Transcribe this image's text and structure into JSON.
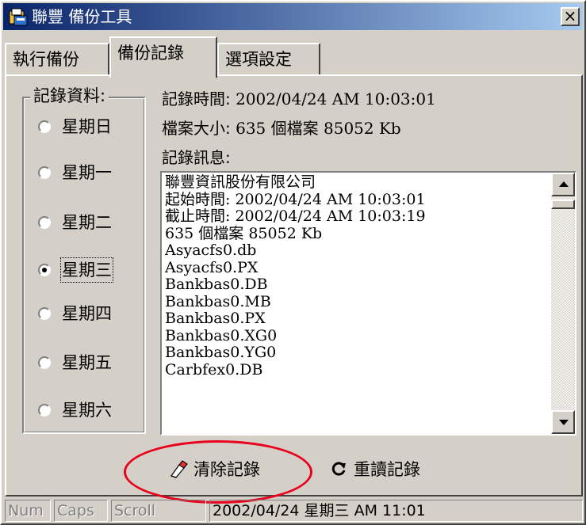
{
  "window": {
    "title": "聯豐 備份工具",
    "close_glyph": "×"
  },
  "tabs": [
    {
      "label": "執行備份",
      "active": false
    },
    {
      "label": "備份記錄",
      "active": true
    },
    {
      "label": "選項設定",
      "active": false
    }
  ],
  "records_group": {
    "label": "記錄資料:",
    "days": [
      {
        "label": "星期日",
        "selected": false
      },
      {
        "label": "星期一",
        "selected": false
      },
      {
        "label": "星期二",
        "selected": false
      },
      {
        "label": "星期三",
        "selected": true
      },
      {
        "label": "星期四",
        "selected": false
      },
      {
        "label": "星期五",
        "selected": false
      },
      {
        "label": "星期六",
        "selected": false
      }
    ]
  },
  "record_info": {
    "time_label": "記錄時間:",
    "time_value": "2002/04/24 AM 10:03:01",
    "size_label": "檔案大小:",
    "size_value": "635 個檔案 85052 Kb",
    "message_label": "記錄訊息:"
  },
  "message_lines": [
    "聯豐資訊股份有限公司",
    "起始時間: 2002/04/24 AM 10:03:01",
    "截止時間: 2002/04/24 AM 10:03:19",
    "635 個檔案 85052 Kb",
    "Asyacfs0.db",
    "Asyacfs0.PX",
    "Bankbas0.DB",
    "Bankbas0.MB",
    "Bankbas0.PX",
    "Bankbas0.XG0",
    "Bankbas0.YG0",
    "Carbfex0.DB"
  ],
  "actions": {
    "clear_label": "清除記錄",
    "clear_icon": "eraser-icon",
    "reload_label": "重讀記錄",
    "reload_icon": "refresh-icon"
  },
  "statusbar": {
    "num": "Num",
    "caps": "Caps",
    "scroll": "Scroll",
    "datetime": "2002/04/24 星期三 AM 11:01"
  },
  "colors": {
    "titlebar_start": "#0a246a",
    "titlebar_end": "#a6caf0",
    "highlight_ring": "#e8001c",
    "face": "#d4d0c8"
  }
}
